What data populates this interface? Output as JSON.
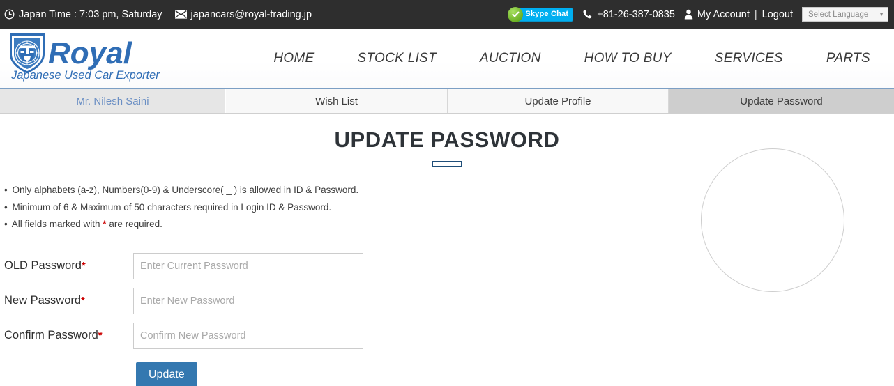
{
  "topbar": {
    "clock_icon": "clock-icon",
    "japan_time": "Japan Time : 7:03 pm, Saturday",
    "mail_icon": "envelope-icon",
    "email": "japancars@royal-trading.jp",
    "skype": {
      "icon": "skype-check-icon",
      "label": "Skype Chat"
    },
    "phone_icon": "phone-icon",
    "phone": "+81-26-387-0835",
    "user_icon": "user-icon",
    "my_account": "My Account",
    "separator": "|",
    "logout": "Logout",
    "language": {
      "value": "Select Language",
      "caret": "▼"
    },
    "bg_color": "#2e2e2e"
  },
  "header": {
    "logo": {
      "icon": "lion-shield-icon",
      "brand": "Royal",
      "tagline": "Japanese Used Car Exporter",
      "color": "#2f6db5"
    },
    "nav": [
      {
        "label": "HOME"
      },
      {
        "label": "STOCK LIST"
      },
      {
        "label": "AUCTION"
      },
      {
        "label": "HOW TO BUY"
      },
      {
        "label": "SERVICES"
      },
      {
        "label": "PARTS"
      }
    ]
  },
  "tabs": [
    {
      "label": "Mr. Nilesh Saini",
      "active": false
    },
    {
      "label": "Wish List",
      "active": false
    },
    {
      "label": "Update Profile",
      "active": false
    },
    {
      "label": "Update Password",
      "active": true
    }
  ],
  "main": {
    "title": "UPDATE PASSWORD",
    "notes": [
      "Only alphabets (a-z), Numbers(0-9) & Underscore( _ ) is allowed in ID & Password.",
      "Minimum of 6 & Maximum of 50 characters required in Login ID & Password.",
      "All fields marked with * are required."
    ],
    "note3_prefix": "All fields marked with ",
    "note3_star": "*",
    "note3_suffix": " are required.",
    "bullet": "•",
    "required_marker": "*",
    "fields": [
      {
        "label": "OLD Password",
        "placeholder": "Enter Current Password",
        "value": ""
      },
      {
        "label": "New Password",
        "placeholder": "Enter New Password",
        "value": ""
      },
      {
        "label": "Confirm Password",
        "placeholder": "Confirm New Password",
        "value": ""
      }
    ],
    "submit_label": "Update",
    "submit_color": "#3478b0"
  }
}
